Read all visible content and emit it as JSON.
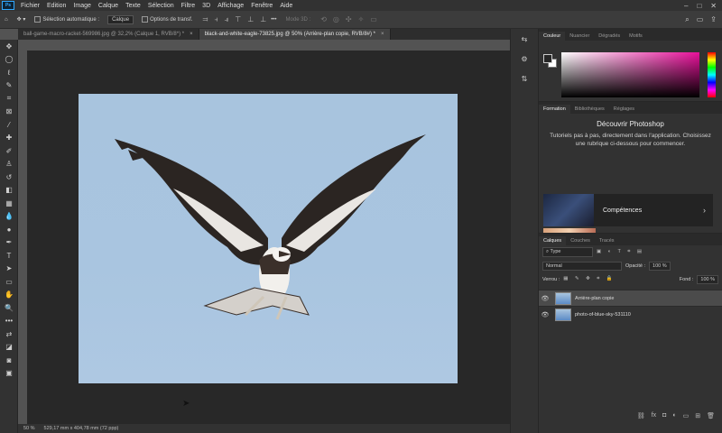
{
  "menu": [
    "Fichier",
    "Edition",
    "Image",
    "Calque",
    "Texte",
    "Sélection",
    "Filtre",
    "3D",
    "Affichage",
    "Fenêtre",
    "Aide"
  ],
  "app_logo": "Ps",
  "options": {
    "auto_select_label": "Sélection automatique :",
    "auto_select_value": "Calque",
    "transform_label": "Options de transf.",
    "mode3d": "Mode 3D :",
    "more": "•••"
  },
  "tabs": [
    {
      "label": "ball-game-macro-racket-569986.jpg @ 32,2% (Calque 1, RVB/8*) *",
      "active": false
    },
    {
      "label": "black-and-white-eagle-73825.jpg @ 50% (Arrière-plan copie, RVB/8#) *",
      "active": true
    }
  ],
  "status": {
    "zoom": "50 %",
    "doc": "529,17 mm x 404,78 mm (72 ppp)"
  },
  "color_panel": {
    "tabs": [
      "Couleur",
      "Nuancier",
      "Dégradés",
      "Motifs"
    ],
    "fg_color": "#262626",
    "bg_color": "#ffffff",
    "accent": "#e8109a"
  },
  "learn_panel": {
    "tabs": [
      "Formation",
      "Bibliothèques",
      "Réglages"
    ],
    "title": "Découvrir Photoshop",
    "text": "Tutoriels pas à pas, directement dans l'application. Choisissez une rubrique ci-dessous pour commencer.",
    "card_label": "Compétences"
  },
  "layers_panel": {
    "tabs": [
      "Calques",
      "Couches",
      "Tracés"
    ],
    "filter_label": "Type",
    "blend_mode": "Normal",
    "opacity_label": "Opacité :",
    "opacity_value": "100 %",
    "lock_label": "Verrou :",
    "fill_label": "Fond :",
    "fill_value": "100 %",
    "layers": [
      {
        "name": "Arrière-plan copie",
        "selected": true
      },
      {
        "name": "photo-of-blue-sky-531110",
        "selected": false
      }
    ]
  }
}
